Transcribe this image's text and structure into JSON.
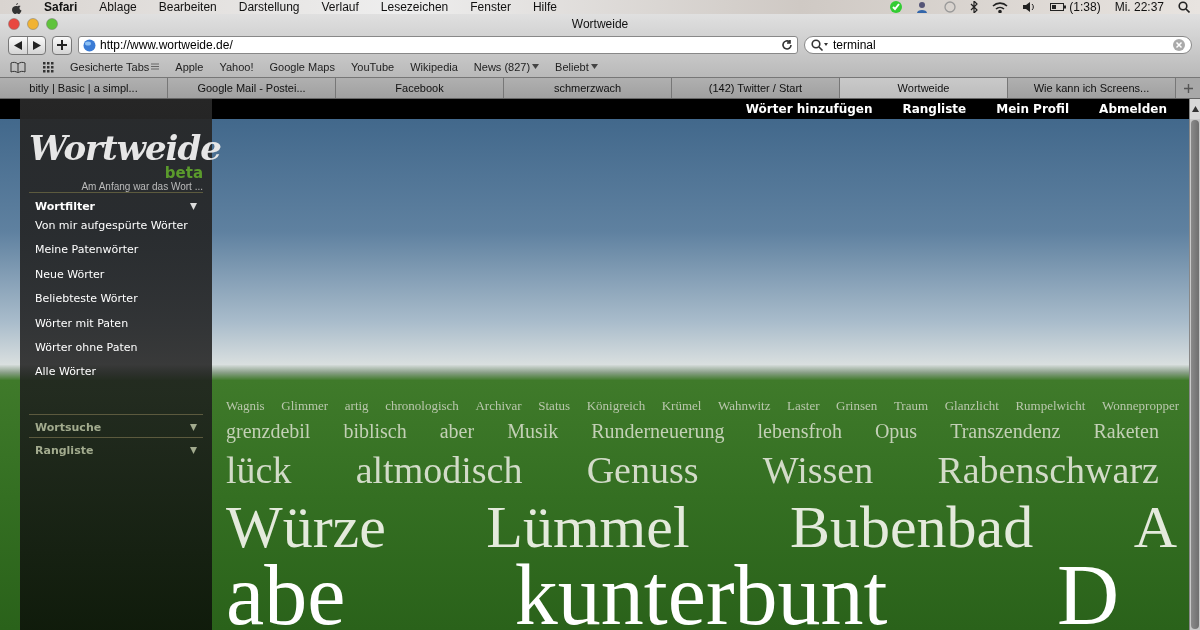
{
  "menubar": {
    "app": "Safari",
    "menus": [
      "Ablage",
      "Bearbeiten",
      "Darstellung",
      "Verlauf",
      "Lesezeichen",
      "Fenster",
      "Hilfe"
    ],
    "battery": "(1:38)",
    "clock": "Mi. 22:37"
  },
  "window": {
    "title": "Wortweide"
  },
  "toolbar": {
    "address": "http://www.wortweide.de/",
    "search": "terminal"
  },
  "bookmarks": [
    {
      "label": "Gesicherte Tabs",
      "kind": "tabs"
    },
    {
      "label": "Apple",
      "kind": "link"
    },
    {
      "label": "Yahoo!",
      "kind": "link"
    },
    {
      "label": "Google Maps",
      "kind": "link"
    },
    {
      "label": "YouTube",
      "kind": "link"
    },
    {
      "label": "Wikipedia",
      "kind": "link"
    },
    {
      "label": "News (827)",
      "kind": "folder"
    },
    {
      "label": "Beliebt",
      "kind": "folder"
    }
  ],
  "tabs": [
    {
      "label": "bitly | Basic | a simpl...",
      "selected": false
    },
    {
      "label": "Google Mail - Postei...",
      "selected": false
    },
    {
      "label": "Facebook",
      "selected": false
    },
    {
      "label": "schmerzwach",
      "selected": false
    },
    {
      "label": "(142) Twitter / Start",
      "selected": false
    },
    {
      "label": "Wortweide",
      "selected": true
    },
    {
      "label": "Wie kann ich Screens...",
      "selected": false
    }
  ],
  "site": {
    "nav": [
      "Wörter hinzufügen",
      "Rangliste",
      "Mein Profil",
      "Abmelden"
    ],
    "logo": "Wortweide",
    "badge": "beta",
    "tagline": "Am Anfang war das Wort ...",
    "sections": [
      {
        "title": "Wortfilter",
        "expanded": true,
        "items": [
          "Von mir aufgespürte Wörter",
          "Meine Patenwörter",
          "Neue Wörter",
          "Beliebteste Wörter",
          "Wörter mit Paten",
          "Wörter ohne Paten",
          "Alle Wörter"
        ]
      },
      {
        "title": "Wortsuche",
        "expanded": false
      },
      {
        "title": "Rangliste",
        "expanded": false
      }
    ],
    "word_cloud": [
      [
        "Wagnis",
        "Glimmer",
        "artig",
        "chronologisch",
        "Archivar",
        "Status",
        "Königreich",
        "Krümel",
        "Wahnwitz",
        "Laster",
        "Grinsen",
        "Traum",
        "Glanzlicht",
        "Rumpelwicht",
        "Wonnepropper"
      ],
      [
        "grenzdebil",
        "biblisch",
        "aber",
        "Musik",
        "Runderneuerung",
        "lebensfroh",
        "Opus",
        "Transzendenz",
        "Raketen"
      ],
      [
        "lück",
        "altmodisch",
        "Genuss",
        "Wissen",
        "Rabenschwarz"
      ],
      [
        "Würze",
        "Lümmel",
        "Bubenbad",
        "A"
      ],
      [
        "abe",
        "kunterbunt",
        "D"
      ]
    ]
  }
}
